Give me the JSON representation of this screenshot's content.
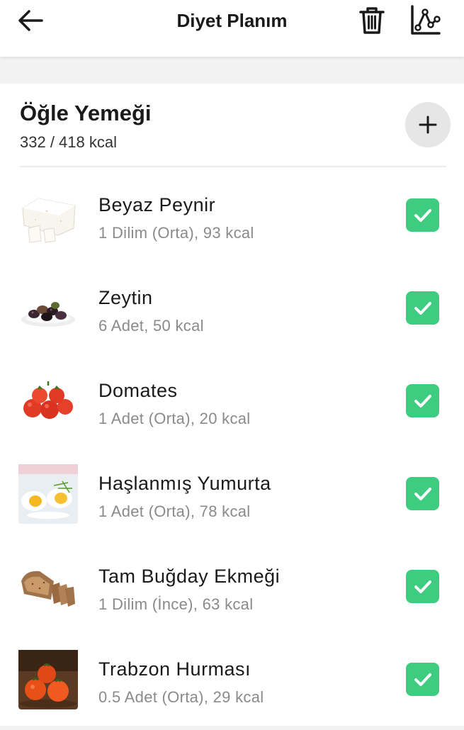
{
  "header": {
    "title": "Diyet Planım",
    "back_icon": "arrow-left-icon",
    "delete_icon": "trash-icon",
    "stats_icon": "line-chart-icon"
  },
  "meal": {
    "title": "Öğle Yemeği",
    "kcal_summary": "332 / 418 kcal",
    "add_icon": "plus-icon"
  },
  "accent_color": "#3dcc80",
  "items": [
    {
      "name": "Beyaz Peynir",
      "detail": "1 Dilim (Orta), 93 kcal",
      "icon": "white-cheese-image",
      "checked": true
    },
    {
      "name": "Zeytin",
      "detail": "6 Adet, 50 kcal",
      "icon": "olives-image",
      "checked": true
    },
    {
      "name": "Domates",
      "detail": "1 Adet (Orta), 20 kcal",
      "icon": "tomatoes-image",
      "checked": true
    },
    {
      "name": "Haşlanmış Yumurta",
      "detail": "1 Adet (Orta), 78 kcal",
      "icon": "boiled-egg-image",
      "checked": true
    },
    {
      "name": "Tam Buğday Ekmeği",
      "detail": "1 Dilim (İnce), 63 kcal",
      "icon": "whole-wheat-bread-image",
      "checked": true
    },
    {
      "name": "Trabzon Hurması",
      "detail": "0.5 Adet (Orta), 29 kcal",
      "icon": "persimmon-image",
      "checked": true
    }
  ]
}
